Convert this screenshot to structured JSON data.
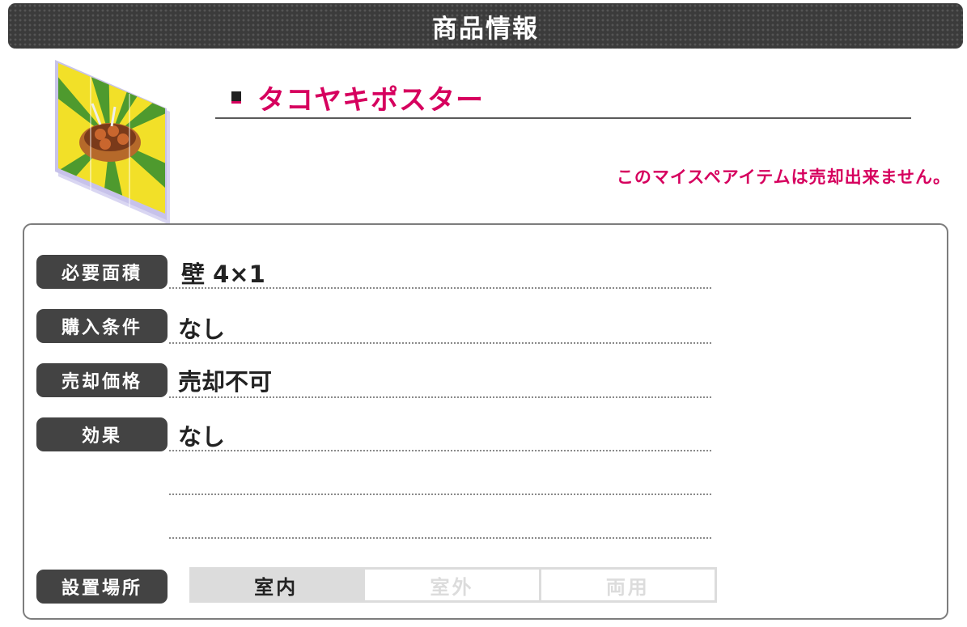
{
  "header": {
    "title": "商品情報"
  },
  "item": {
    "name": "タコヤキポスター",
    "notice": "このマイスペアイテムは売却出来ません。",
    "image_icon": "takoyaki-poster-icon"
  },
  "details": [
    {
      "label": "必要面積",
      "value": "壁 4×1"
    },
    {
      "label": "購入条件",
      "value": "なし"
    },
    {
      "label": "売却価格",
      "value": "売却不可"
    },
    {
      "label": "効果",
      "value": "なし"
    }
  ],
  "placement": {
    "label": "設置場所",
    "options": [
      {
        "label": "室内",
        "active": true
      },
      {
        "label": "室外",
        "active": false
      },
      {
        "label": "両用",
        "active": false
      }
    ]
  },
  "colors": {
    "accent": "#d6005e",
    "label_bg": "#434343",
    "header_bg": "#3b3b3b"
  }
}
